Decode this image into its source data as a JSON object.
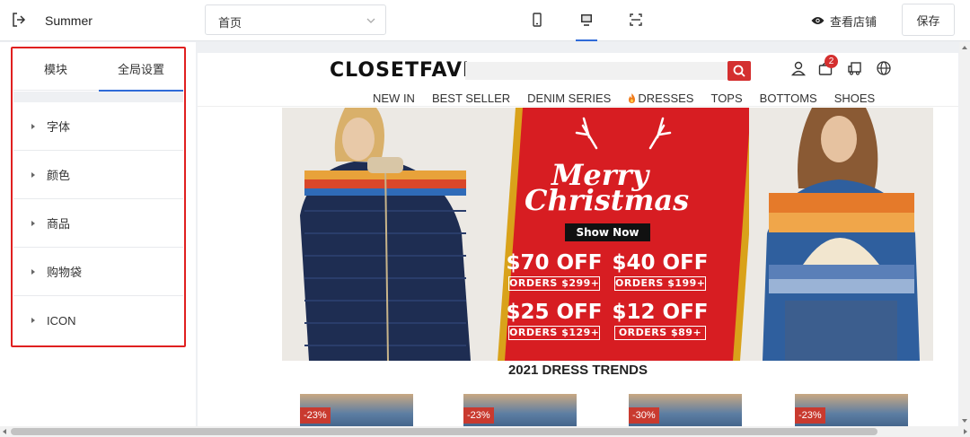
{
  "app": {
    "title": "Summer"
  },
  "page_select": {
    "value": "首页"
  },
  "devices": [
    {
      "icon": "mobile-icon",
      "active": false
    },
    {
      "icon": "desktop-icon",
      "active": true
    },
    {
      "icon": "fullscreen-icon",
      "active": false
    }
  ],
  "toolbar": {
    "view_store_label": "查看店铺",
    "save_label": "保存"
  },
  "sidebar": {
    "tabs": [
      {
        "label": "模块",
        "active": false
      },
      {
        "label": "全局设置",
        "active": true
      }
    ],
    "items": [
      {
        "label": "字体"
      },
      {
        "label": "颜色"
      },
      {
        "label": "商品"
      },
      {
        "label": "购物袋"
      },
      {
        "label": "ICON"
      }
    ]
  },
  "store": {
    "logo": "CLOSETFAVES",
    "cart_count": "2",
    "nav": [
      "NEW IN",
      "BEST SELLER",
      "DENIM SERIES",
      "DRESSES",
      "TOPS",
      "BOTTOMS",
      "SHOES"
    ],
    "banner": {
      "script_line1": "Merry",
      "script_line2": "Christmas",
      "cta": "Show Now",
      "offers": [
        {
          "amount": "$70 OFF",
          "orders": "ORDERS $299+"
        },
        {
          "amount": "$40 OFF",
          "orders": "ORDERS $199+"
        },
        {
          "amount": "$25 OFF",
          "orders": "ORDERS $129+"
        },
        {
          "amount": "$12 OFF",
          "orders": "ORDERS $89+"
        }
      ]
    },
    "section_title": "2021 DRESS TRENDS",
    "products": [
      {
        "discount": "-23%"
      },
      {
        "discount": "-23%"
      },
      {
        "discount": "-30%"
      },
      {
        "discount": "-23%"
      }
    ]
  },
  "colors": {
    "accent": "#2f6bd8",
    "highlight": "#e02020",
    "brand_red": "#d42f2f"
  }
}
